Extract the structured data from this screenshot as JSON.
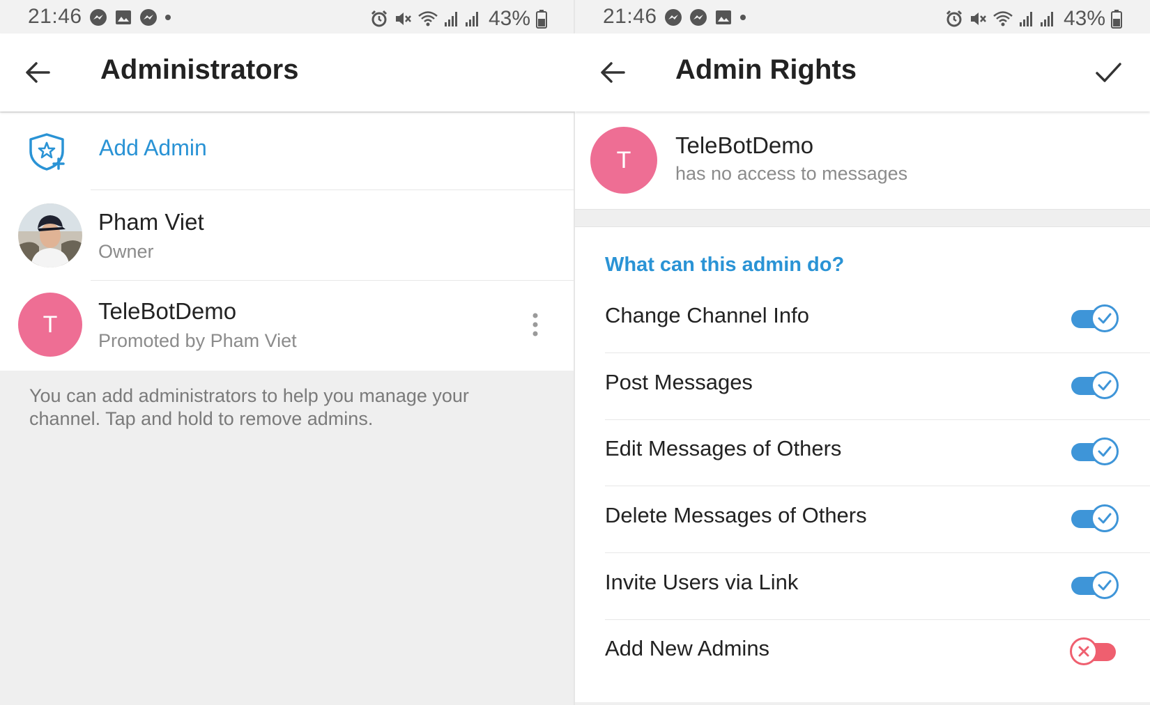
{
  "left": {
    "status": {
      "time": "21:46",
      "battery": "43%"
    },
    "appbar": {
      "title": "Administrators"
    },
    "add_admin_label": "Add Admin",
    "admins": [
      {
        "name": "Pham Viet",
        "subtitle": "Owner"
      },
      {
        "name": "TeleBotDemo",
        "subtitle": "Promoted by Pham Viet",
        "avatar_letter": "T"
      }
    ],
    "footer": "You can add administrators to help you manage your channel. Tap and hold to remove admins."
  },
  "right": {
    "status": {
      "time": "21:46",
      "battery": "43%"
    },
    "appbar": {
      "title": "Admin Rights"
    },
    "bot": {
      "avatar_letter": "T",
      "name": "TeleBotDemo",
      "subtitle": "has no access to messages"
    },
    "section_title": "What can this admin do?",
    "permissions": [
      {
        "label": "Change Channel Info",
        "enabled": true
      },
      {
        "label": "Post Messages",
        "enabled": true
      },
      {
        "label": "Edit Messages of Others",
        "enabled": true
      },
      {
        "label": "Delete Messages of Others",
        "enabled": true
      },
      {
        "label": "Invite Users via Link",
        "enabled": true
      },
      {
        "label": "Add New Admins",
        "enabled": false
      }
    ]
  },
  "colors": {
    "accent": "#2a93d5",
    "toggle_on": "#3e95d8",
    "toggle_off": "#ef5f6f",
    "avatar_bot": "#ee6e94"
  },
  "icons": [
    "messenger-icon",
    "gallery-icon",
    "alarm-icon",
    "mute-icon",
    "wifi-icon",
    "signal-icon",
    "battery-icon",
    "back-arrow-icon",
    "check-icon",
    "shield-star-add-icon",
    "more-vert-icon"
  ]
}
